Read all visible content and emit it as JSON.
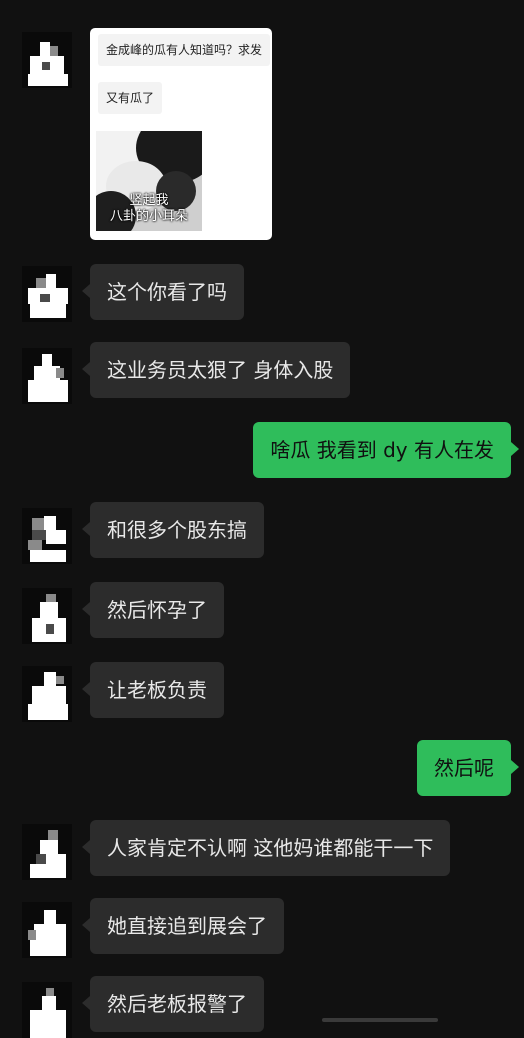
{
  "chat": {
    "shared_card": {
      "line1": "金成峰的瓜有人知道吗？求发",
      "line2": "又有瓜了",
      "sticker_caption_1": "竖起我",
      "sticker_caption_2": "八卦的小耳朵"
    },
    "messages": [
      {
        "side": "in",
        "text": "这个你看了吗"
      },
      {
        "side": "in",
        "text": "这业务员太狠了 身体入股"
      },
      {
        "side": "out",
        "text": "啥瓜 我看到 dy 有人在发"
      },
      {
        "side": "in",
        "text": "和很多个股东搞"
      },
      {
        "side": "in",
        "text": "然后怀孕了"
      },
      {
        "side": "in",
        "text": "让老板负责"
      },
      {
        "side": "out",
        "text": "然后呢"
      },
      {
        "side": "in",
        "text": "人家肯定不认啊 这他妈谁都能干一下"
      },
      {
        "side": "in",
        "text": "她直接追到展会了"
      },
      {
        "side": "in",
        "text": "然后老板报警了"
      }
    ]
  },
  "colors": {
    "background": "#111111",
    "incoming_bubble": "#2c2c2c",
    "outgoing_bubble": "#2fbd5b"
  }
}
